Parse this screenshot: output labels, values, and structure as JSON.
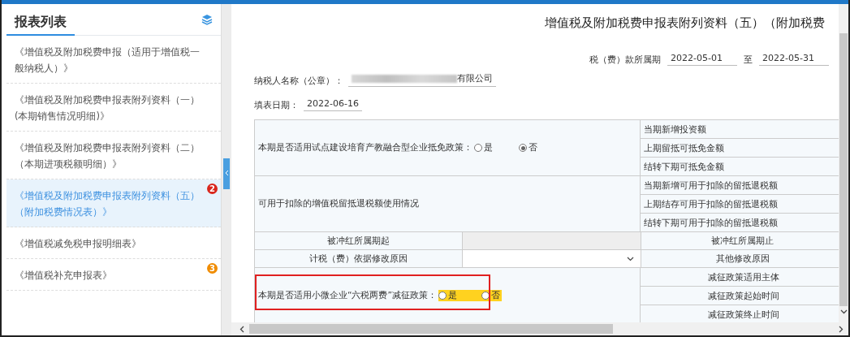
{
  "sidebar": {
    "title": "报表列表",
    "items": [
      {
        "label": "《增值税及附加税费申报（适用于增值税一般纳税人）》",
        "selected": false
      },
      {
        "label": "《增值税及附加税费申报表附列资料（一）(本期销售情况明细)》",
        "selected": false
      },
      {
        "label": "《增值税及附加税费申报表附列资料（二）（本期进项税额明细）》",
        "selected": false
      },
      {
        "label": "《增值税及附加税费申报表附列资料（五）（附加税费情况表）》",
        "selected": true,
        "badge": "2",
        "color": "#d9261c"
      },
      {
        "label": "《增值税减免税申报明细表》",
        "selected": false
      },
      {
        "label": "《增值税补充申报表》",
        "selected": false,
        "badge": "3",
        "color": "#f08c00"
      }
    ]
  },
  "form": {
    "title": "增值税及附加税费申报表附列资料（五）（附加税费",
    "period": {
      "label": "税（费）款所属期",
      "start": "2022-05-01",
      "separator": "至",
      "end": "2022-05-31"
    },
    "taxpayer": {
      "label": "纳税人名称（公章）：",
      "value": "有限公司"
    },
    "fill_date": {
      "label": "填表日期：",
      "value": "2022-06-16"
    }
  },
  "table": {
    "rows": [
      {
        "kind": "radio_group",
        "label": "本期是否适用试点建设培育产教融合型企业抵免政策：",
        "highlighted": false,
        "options": [
          {
            "label": "是",
            "selected": false
          },
          {
            "label": "否",
            "selected": true
          }
        ],
        "items": [
          "当期新增投资额",
          "上期留抵可抵免金额",
          "结转下期可抵免金额"
        ]
      },
      {
        "kind": "group",
        "label": "可用于扣除的增值税留抵退税额使用情况",
        "items": [
          "当期新增可用于扣除的留抵退税额",
          "上期结存可用于扣除的留抵退税额",
          "结转下期可用于扣除的留抵退税额"
        ]
      },
      {
        "kind": "pair",
        "label": "被冲红所属期起",
        "right": "被冲红所属期止"
      },
      {
        "kind": "select",
        "label": "计税（费）依据修改原因",
        "right": "其他修改原因"
      },
      {
        "kind": "radio_group",
        "label": "本期是否适用小微企业“六税两费”减征政策：",
        "highlighted": true,
        "options": [
          {
            "label": "是",
            "selected": false
          },
          {
            "label": "否",
            "selected": false
          }
        ],
        "items": [
          "减征政策适用主体",
          "减征政策起始时间",
          "减征政策终止时间"
        ]
      }
    ]
  }
}
